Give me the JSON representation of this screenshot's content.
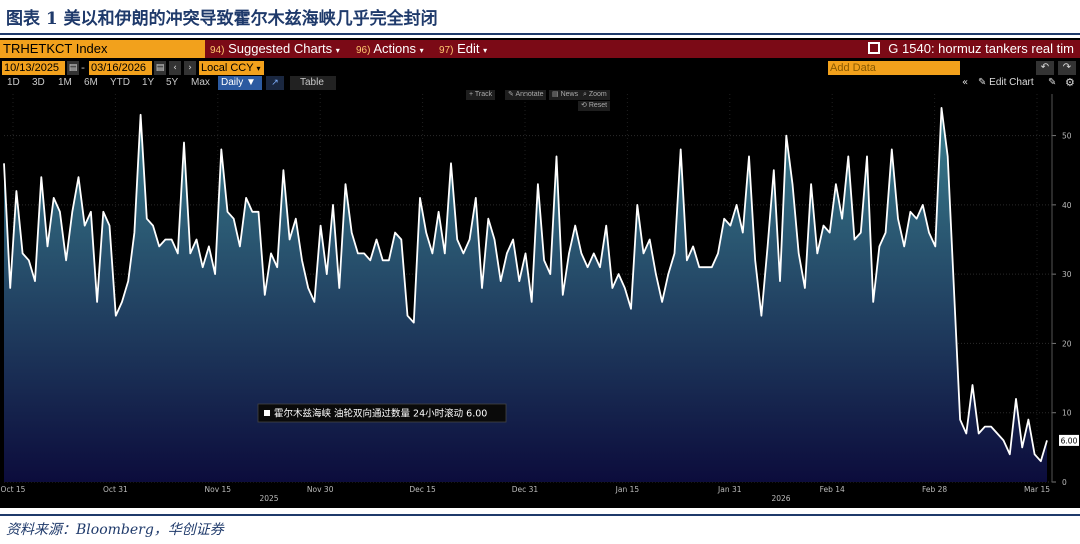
{
  "figure": {
    "title": "图表 1  美以和伊朗的冲突导致霍尔木兹海峡几乎完全封闭",
    "source": "资料来源：Bloomberg，华创证券"
  },
  "terminal": {
    "ticker": "TRHETKCT Index",
    "menu": [
      {
        "num": "94)",
        "label": "Suggested Charts"
      },
      {
        "num": "96)",
        "label": "Actions"
      },
      {
        "num": "97)",
        "label": "Edit"
      }
    ],
    "page_title": "G 1540: hormuz tankers real tim",
    "start_date": "10/13/2025",
    "end_date": "03/16/2026",
    "currency": "Local CCY",
    "ranges": [
      "1D",
      "3D",
      "1M",
      "6M",
      "YTD",
      "1Y",
      "5Y",
      "Max"
    ],
    "frequency": "Daily",
    "table_label": "Table",
    "add_data_placeholder": "Add Data",
    "edit_chart_label": "Edit Chart",
    "tools": [
      "Track",
      "Annotate",
      "News",
      "Zoom"
    ],
    "reset_label": "Reset",
    "colors": {
      "ticker_bg": "#f2a11c",
      "menu_bg": "#7b0a16",
      "line": "#ffffff",
      "fill_top": "#3a7f8e",
      "fill_bottom": "#0c0c3c"
    }
  },
  "chart_data": {
    "type": "area",
    "ylim": [
      0,
      56
    ],
    "y_ticks": [
      0,
      10,
      20,
      30,
      40,
      50
    ],
    "x_tick_labels": [
      "Oct 15",
      "Oct 31",
      "Nov 15",
      "Nov 30",
      "Dec 15",
      "Dec 31",
      "Jan 15",
      "Jan 31",
      "Feb 14",
      "Feb 28",
      "Mar 15"
    ],
    "year_labels": [
      {
        "label": "2025",
        "after": "Nov 15"
      },
      {
        "label": "2026",
        "after": "Jan 31"
      }
    ],
    "legend": "霍尔木兹海峡 油轮双向通过数量 24小时滚动 6.00",
    "last_value_label": "6.00",
    "series": [
      {
        "name": "霍尔木兹海峡 油轮双向通过数量 24小时滚动",
        "values": [
          46,
          28,
          42,
          33,
          32,
          29,
          44,
          34,
          41,
          39,
          32,
          39,
          44,
          37,
          39,
          26,
          39,
          37,
          24,
          26,
          29,
          36,
          53,
          38,
          37,
          34,
          35,
          35,
          33,
          49,
          33,
          35,
          31,
          34,
          30,
          48,
          39,
          38,
          34,
          41,
          39,
          39,
          27,
          33,
          31,
          45,
          35,
          38,
          32,
          28,
          26,
          37,
          30,
          40,
          28,
          43,
          36,
          33,
          33,
          32,
          35,
          32,
          32,
          36,
          35,
          24,
          23,
          41,
          36,
          33,
          39,
          33,
          46,
          35,
          33,
          35,
          41,
          28,
          38,
          35,
          29,
          33,
          35,
          29,
          33,
          26,
          43,
          32,
          30,
          47,
          27,
          33,
          37,
          33,
          31,
          33,
          31,
          37,
          28,
          30,
          28,
          25,
          40,
          33,
          35,
          30,
          26,
          30,
          33,
          48,
          32,
          34,
          31,
          31,
          31,
          33,
          38,
          37,
          40,
          36,
          47,
          32,
          24,
          34,
          45,
          29,
          50,
          43,
          33,
          28,
          43,
          33,
          37,
          36,
          43,
          38,
          47,
          35,
          36,
          47,
          26,
          34,
          36,
          48,
          38,
          34,
          39,
          38,
          40,
          36,
          34,
          54,
          47,
          28,
          9,
          7,
          14,
          7,
          8,
          8,
          7,
          6,
          4,
          12,
          5,
          9,
          4,
          3,
          6
        ]
      }
    ]
  }
}
